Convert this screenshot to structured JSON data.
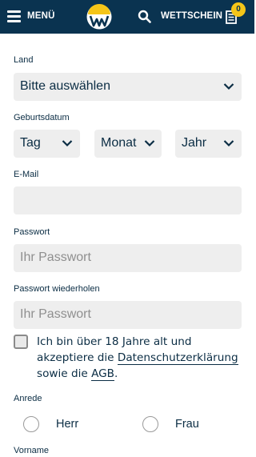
{
  "header": {
    "menu_label": "MENÜ",
    "wettschein_label": "WETTSCHEIN",
    "badge_count": "0",
    "colors": {
      "background": "#0a3350",
      "badge": "#f5c518",
      "logo": "#f5c518"
    }
  },
  "form": {
    "land": {
      "label": "Land",
      "value": "Bitte auswählen"
    },
    "geburtsdatum": {
      "label": "Geburtsdatum",
      "tag": "Tag",
      "monat": "Monat",
      "jahr": "Jahr"
    },
    "email": {
      "label": "E-Mail",
      "value": "",
      "placeholder": ""
    },
    "passwort": {
      "label": "Passwort",
      "placeholder": "Ihr Passwort"
    },
    "passwort_wiederholen": {
      "label": "Passwort wiederholen",
      "placeholder": "Ihr Passwort"
    },
    "consent": {
      "checked": false,
      "text_before": "Ich bin über 18 Jahre alt und akzeptiere die ",
      "datenschutz_link": "Datenschutzerklärung",
      "text_middle": " sowie die ",
      "agb_link": "AGB",
      "text_after": "."
    },
    "anrede": {
      "label": "Anrede",
      "options": [
        "Herr",
        "Frau"
      ]
    },
    "vorname": {
      "label": "Vorname"
    }
  }
}
